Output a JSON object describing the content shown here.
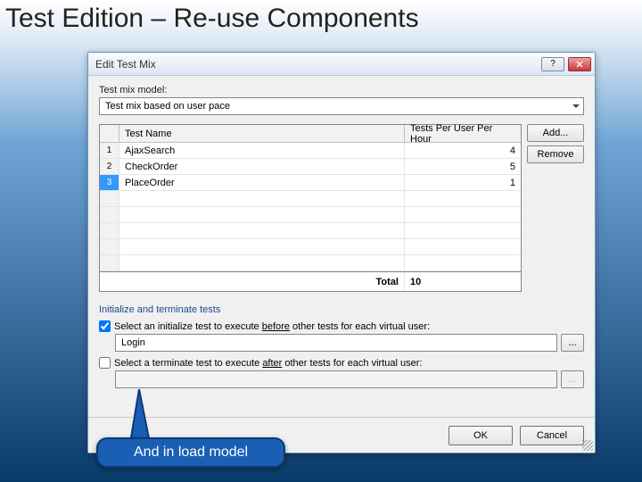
{
  "slide": {
    "title": "Test Edition – Re-use Components"
  },
  "dialog": {
    "title": "Edit Test Mix",
    "model_label": "Test mix model:",
    "model_value": "Test mix based on user pace",
    "columns": {
      "name": "Test Name",
      "tests": "Tests Per User Per Hour"
    },
    "rows": [
      {
        "n": "1",
        "name": "AjaxSearch",
        "val": "4",
        "selected": false
      },
      {
        "n": "2",
        "name": "CheckOrder",
        "val": "5",
        "selected": false
      },
      {
        "n": "3",
        "name": "PlaceOrder",
        "val": "1",
        "selected": true
      }
    ],
    "total_label": "Total",
    "total_value": "10",
    "buttons": {
      "add": "Add...",
      "remove": "Remove"
    },
    "init_section": "Initialize and terminate tests",
    "init_check_label_pre": "Select an initialize test to execute ",
    "init_check_label_u": "before",
    "init_check_label_post": " other tests for each virtual user:",
    "init_checked": true,
    "init_value": "Login",
    "term_check_label_pre": "Select a terminate test to execute ",
    "term_check_label_u": "after",
    "term_check_label_post": " other tests for each virtual user:",
    "term_checked": false,
    "term_value": "",
    "ellipsis": "...",
    "ok": "OK",
    "cancel": "Cancel"
  },
  "callout": {
    "text": "And in load model"
  }
}
